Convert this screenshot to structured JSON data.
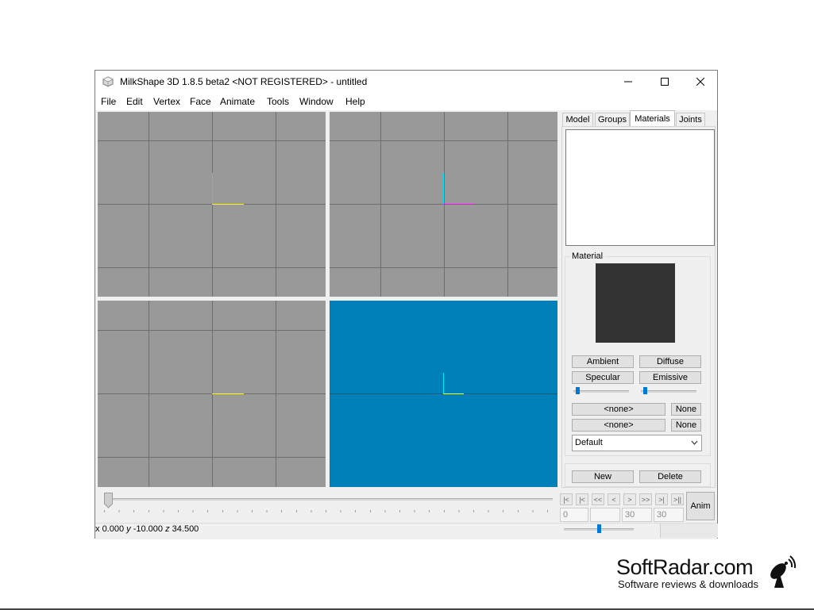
{
  "window": {
    "title": "MilkShape 3D 1.8.5 beta2 <NOT REGISTERED> - untitled",
    "controls": {
      "minimize": "─",
      "maximize": "☐",
      "close": "✕"
    }
  },
  "menu": [
    "File",
    "Edit",
    "Vertex",
    "Face",
    "Animate",
    "Tools",
    "Window",
    "Help"
  ],
  "tabs": {
    "model": "Model",
    "groups": "Groups",
    "materials": "Materials",
    "joints": "Joints"
  },
  "material_panel": {
    "group_label": "Material",
    "preview_color": "#333333",
    "buttons": {
      "ambient": "Ambient",
      "diffuse": "Diffuse",
      "specular": "Specular",
      "emissive": "Emissive"
    },
    "texture_1": "<none>",
    "texture_1_clear": "None",
    "texture_2": "<none>",
    "texture_2_clear": "None",
    "mode_select": "Default"
  },
  "material_actions": {
    "new": "New",
    "delete": "Delete"
  },
  "timeline": {
    "buttons": [
      "|<",
      "|<",
      "<<",
      "<",
      ">",
      ">>",
      ">|",
      ">||"
    ],
    "frame_current": "0",
    "frame_field2": "",
    "frame_start": "30",
    "frame_end": "30",
    "anim_label": "Anim"
  },
  "status": {
    "x_label": "x",
    "x_value": "0.000",
    "y_label": "y",
    "y_value": "-10.000",
    "z_label": "z",
    "z_value": "34.500"
  },
  "colors": {
    "viewport_grey": "#999999",
    "viewport_3d": "#0080b8",
    "axis_cyan": "#00e5ff",
    "axis_yellow": "#ffff00",
    "axis_magenta": "#ff00ff"
  },
  "watermark": {
    "name": "SoftRadar.com",
    "tagline": "Software reviews & downloads"
  }
}
